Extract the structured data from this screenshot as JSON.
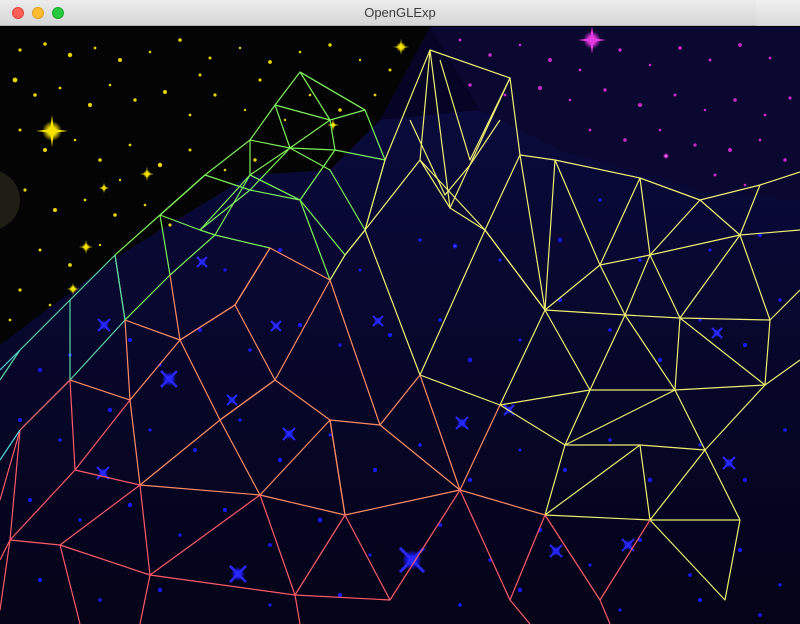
{
  "window": {
    "title": "OpenGLExp"
  },
  "controls": {
    "close": "close-window",
    "minimize": "minimize-window",
    "maximize": "maximize-window"
  },
  "colors": {
    "background": "#050424",
    "yellow_starfield": "#e8d400",
    "magenta_starfield": "#d824d8",
    "blue_stars": "#1818ff",
    "mesh_green": "#7cf05a",
    "mesh_yellow": "#f2f27a",
    "mesh_pink": "#ff5a6a",
    "mesh_cyan": "#4fd6d6"
  }
}
